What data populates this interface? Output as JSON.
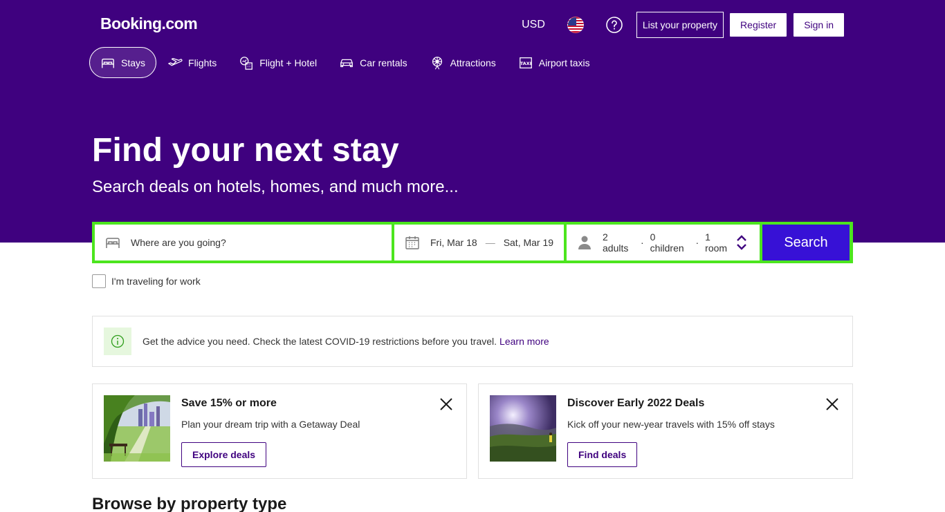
{
  "header": {
    "logo": "Booking.com",
    "currency": "USD",
    "list_property": "List your property",
    "register": "Register",
    "sign_in": "Sign in"
  },
  "nav": {
    "items": [
      {
        "label": "Stays",
        "icon": "bed-icon",
        "active": true
      },
      {
        "label": "Flights",
        "icon": "plane-icon"
      },
      {
        "label": "Flight + Hotel",
        "icon": "plane-hotel-icon"
      },
      {
        "label": "Car rentals",
        "icon": "car-icon"
      },
      {
        "label": "Attractions",
        "icon": "attractions-icon"
      },
      {
        "label": "Airport taxis",
        "icon": "taxi-icon"
      }
    ]
  },
  "hero": {
    "title": "Find your next stay",
    "subtitle": "Search deals on hotels, homes, and much more..."
  },
  "search": {
    "destination_placeholder": "Where are you going?",
    "checkin": "Fri, Mar 18",
    "checkout": "Sat, Mar 19",
    "adults": "2 adults",
    "children": "0 children",
    "rooms": "1 room",
    "button": "Search",
    "work_label": "I'm traveling for work"
  },
  "covid": {
    "text": "Get the advice you need. Check the latest COVID-19 restrictions before you travel.",
    "link": "Learn more"
  },
  "cards": [
    {
      "title": "Save 15% or more",
      "desc": "Plan your dream trip with a Getaway Deal",
      "cta": "Explore deals"
    },
    {
      "title": "Discover Early 2022 Deals",
      "desc": "Kick off your new-year travels with 15% off stays",
      "cta": "Find deals"
    }
  ],
  "browse": {
    "title": "Browse by property type"
  },
  "colors": {
    "brand": "#3f017f",
    "search_border": "#4ce51e",
    "search_button": "#3711d6"
  }
}
